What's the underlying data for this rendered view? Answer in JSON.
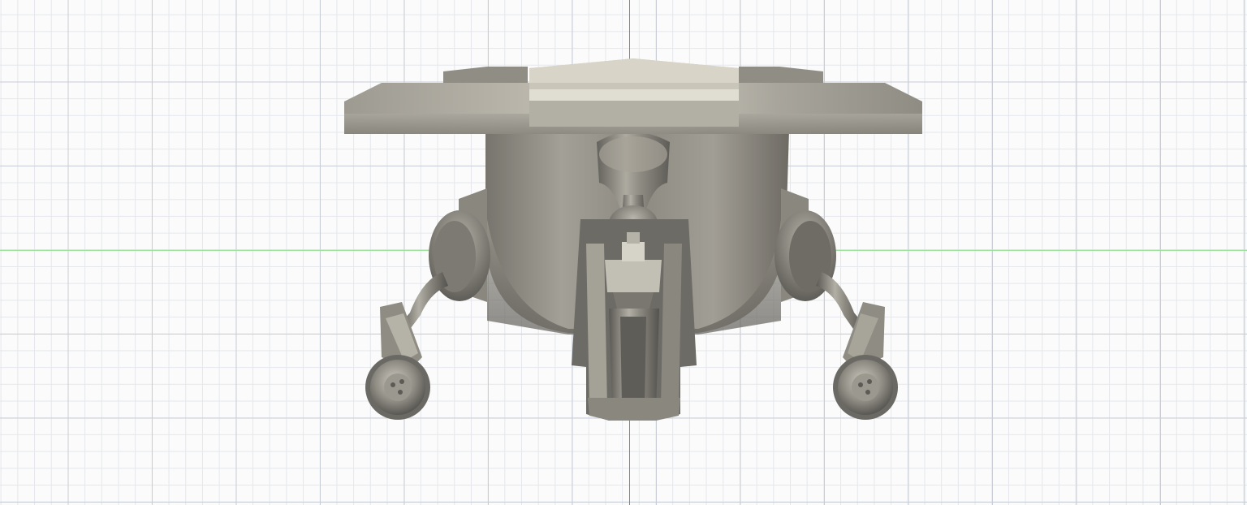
{
  "viewport": {
    "background_color": "#fbfbfb",
    "grid_major_color": "#c9ced6",
    "grid_minor_color": "#e4e7ec",
    "axis_vertical_color": "#6b7fd6",
    "axis_horizontal_color": "#9be39b"
  },
  "model": {
    "icon": "lander-3d-model",
    "base_color": "#8a877f",
    "highlight_color": "#d9d6cc",
    "shadow_color": "#4f4d48"
  }
}
